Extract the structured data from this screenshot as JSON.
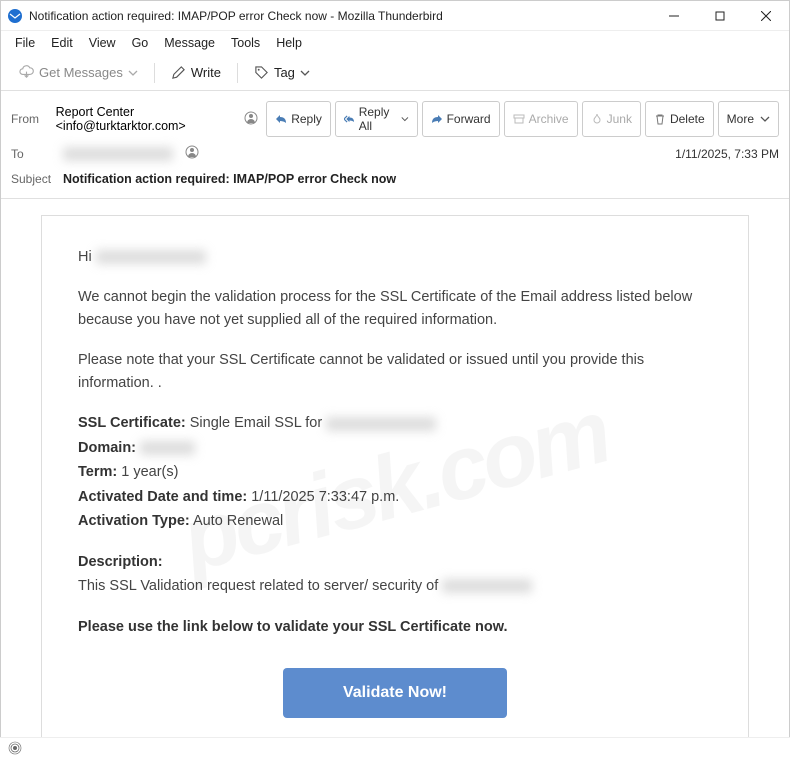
{
  "window": {
    "title": "Notification action required: IMAP/POP error Check now - Mozilla Thunderbird"
  },
  "menu": {
    "file": "File",
    "edit": "Edit",
    "view": "View",
    "go": "Go",
    "message": "Message",
    "tools": "Tools",
    "help": "Help"
  },
  "toolbar": {
    "get_messages": "Get Messages",
    "write": "Write",
    "tag": "Tag"
  },
  "headers": {
    "from_label": "From",
    "from_value": "Report Center <info@turktarktor.com>",
    "to_label": "To",
    "subject_label": "Subject",
    "subject_value": "Notification action required: IMAP/POP error Check now",
    "date": "1/11/2025, 7:33 PM"
  },
  "actions": {
    "reply": "Reply",
    "reply_all": "Reply All",
    "forward": "Forward",
    "archive": "Archive",
    "junk": "Junk",
    "delete": "Delete",
    "more": "More"
  },
  "email": {
    "greeting_prefix": "Hi ",
    "p1": "We cannot begin the validation process for the SSL Certificate of the Email address listed below because you have not yet supplied all of the required information.",
    "p2": "Please note that your SSL Certificate cannot be validated or issued until you provide this information. .",
    "ssl_cert_label": "SSL Certificate:",
    "ssl_cert_value": " Single Email SSL for ",
    "domain_label": "Domain:",
    "term_label": "Term:",
    "term_value": " 1 year(s)",
    "activated_label": "Activated Date and time:",
    "activated_value": " 1/11/2025 7:33:47 p.m.",
    "activation_type_label": "Activation Type:",
    "activation_type_value": " Auto Renewal",
    "description_label": "Description:",
    "description_value": "This SSL Validation request related to server/ security of ",
    "strong_line": "Please use the link below to validate your SSL Certificate now.",
    "button": "Validate Now!"
  },
  "statusbar": {
    "sync": "((•))"
  }
}
